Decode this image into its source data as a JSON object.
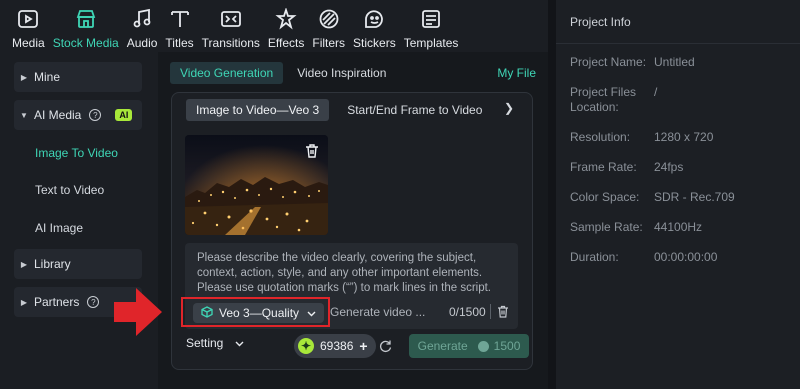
{
  "toolbar": {
    "items": [
      {
        "label": "Media",
        "icon": "media-icon"
      },
      {
        "label": "Stock Media",
        "icon": "stock-media-icon"
      },
      {
        "label": "Audio",
        "icon": "audio-icon"
      },
      {
        "label": "Titles",
        "icon": "titles-icon"
      },
      {
        "label": "Transitions",
        "icon": "transitions-icon"
      },
      {
        "label": "Effects",
        "icon": "effects-icon"
      },
      {
        "label": "Filters",
        "icon": "filters-icon"
      },
      {
        "label": "Stickers",
        "icon": "stickers-icon"
      },
      {
        "label": "Templates",
        "icon": "templates-icon"
      }
    ],
    "active": "Stock Media",
    "accent_color": "#3fd6b6"
  },
  "sidebar": {
    "mine": "Mine",
    "ai_media": "AI Media",
    "ai_badge": "AI",
    "sub_items": [
      "Image To Video",
      "Text to Video",
      "AI Image"
    ],
    "library": "Library",
    "partners": "Partners"
  },
  "main": {
    "tabs": [
      "Video Generation",
      "Video Inspiration"
    ],
    "my_file": "My File",
    "mode_tabs": [
      "Image to Video—Veo 3",
      "Start/End Frame to Video"
    ],
    "prompt_placeholder": "Please describe the video clearly, covering the subject, context, action, style, and any other important elements. Please use quotation marks (“”) to mark lines in the script.",
    "model_label": "Veo 3—Quality",
    "generate_input": "Generate video ...",
    "counter": "0/1500",
    "setting": "Setting",
    "credits": "69386",
    "generate_label": "Generate",
    "generate_cost": "1500"
  },
  "project_info": {
    "title": "Project Info",
    "rows": [
      {
        "key": "Project Name:",
        "value": "Untitled"
      },
      {
        "key": "Project Files Location:",
        "value": "/"
      },
      {
        "key": "Resolution:",
        "value": "1280 x 720"
      },
      {
        "key": "Frame Rate:",
        "value": "24fps"
      },
      {
        "key": "Color Space:",
        "value": "SDR - Rec.709"
      },
      {
        "key": "Sample Rate:",
        "value": "44100Hz"
      },
      {
        "key": "Duration:",
        "value": "00:00:00:00"
      }
    ]
  }
}
